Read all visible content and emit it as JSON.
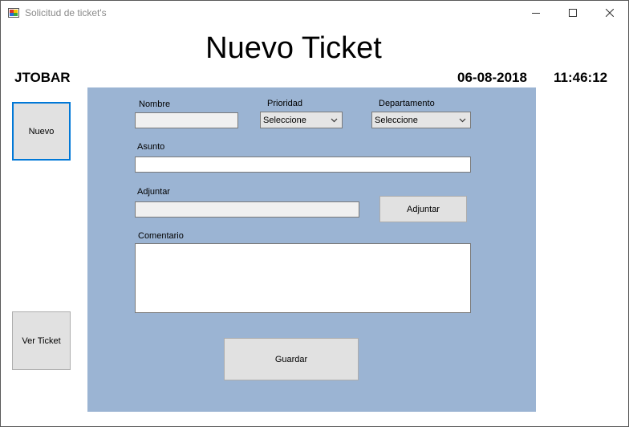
{
  "window": {
    "title": "Solicitud de ticket's"
  },
  "header": {
    "title": "Nuevo Ticket",
    "user": "JTOBAR",
    "date": "06-08-2018",
    "time": "11:46:12"
  },
  "sidebar": {
    "new_label": "Nuevo",
    "view_label": "Ver Ticket"
  },
  "form": {
    "nombre_label": "Nombre",
    "nombre_value": "",
    "prioridad_label": "Prioridad",
    "prioridad_selected": "Seleccione",
    "departamento_label": "Departamento",
    "departamento_selected": "Seleccione",
    "asunto_label": "Asunto",
    "asunto_value": "",
    "adjuntar_label": "Adjuntar",
    "adjuntar_value": "",
    "adjuntar_button": "Adjuntar",
    "comentario_label": "Comentario",
    "comentario_value": "",
    "save_button": "Guardar"
  },
  "colors": {
    "panel": "#9bb4d3",
    "focus_border": "#0078d7",
    "button_face": "#e1e1e1"
  }
}
